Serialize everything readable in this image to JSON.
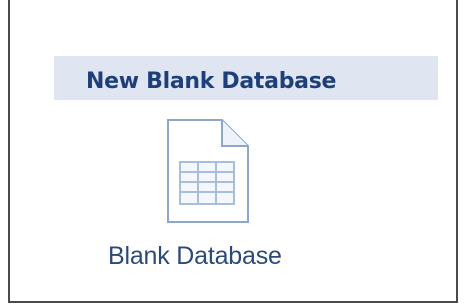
{
  "section": {
    "title": "New Blank Database"
  },
  "tile": {
    "label": "Blank Database",
    "icon": "blank-database-document-icon"
  },
  "colors": {
    "header_background": "#dfe6f1",
    "header_text": "#1f3f7a",
    "label_text": "#2c4a78",
    "icon_stroke": "#8da6c9",
    "icon_grid": "#a9bedb"
  }
}
